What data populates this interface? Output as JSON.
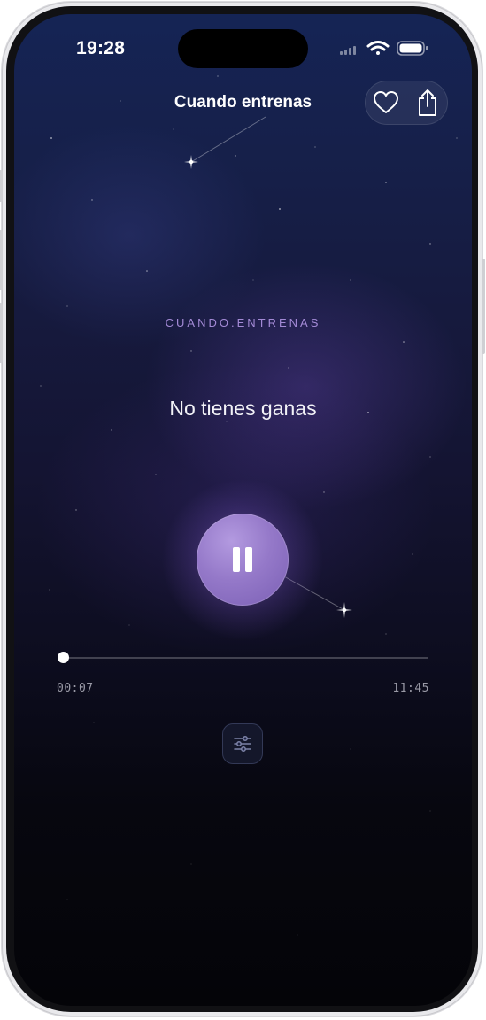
{
  "status_bar": {
    "time": "19:28",
    "signal_icon": "cellular-signal-icon",
    "wifi_icon": "wifi-icon",
    "battery_icon": "battery-icon"
  },
  "header": {
    "title": "Cuando entrenas",
    "favorite_icon": "heart-icon",
    "share_icon": "share-icon"
  },
  "player": {
    "category": "CUANDO.ENTRENAS",
    "track_title": "No tienes ganas",
    "state_icon": "pause-icon",
    "progress": 0.01,
    "elapsed": "00:07",
    "duration": "11:45",
    "settings_icon": "sliders-icon"
  },
  "colors": {
    "accent": "#9a7fd0",
    "category_text": "#a38ad6",
    "background_top": "#152455",
    "background_bottom": "#040408"
  }
}
